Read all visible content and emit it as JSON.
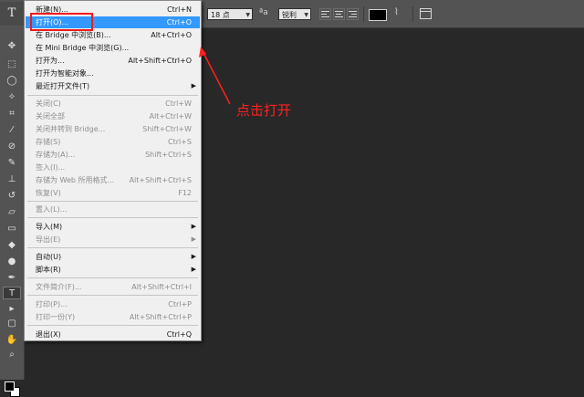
{
  "options_bar": {
    "tool_glyph": "T",
    "font_size": "18 点",
    "aa_glyph": "ªa",
    "aa_mode": "锐利"
  },
  "menu_items": [
    {
      "label": "新建(N)...",
      "shortcut": "Ctrl+N"
    },
    {
      "label": "打开(O)...",
      "shortcut": "Ctrl+O"
    },
    {
      "label": "在 Bridge 中浏览(B)...",
      "shortcut": "Alt+Ctrl+O"
    },
    {
      "label": "在 Mini Bridge 中浏览(G)...",
      "shortcut": ""
    },
    {
      "label": "打开为...",
      "shortcut": "Alt+Shift+Ctrl+O"
    },
    {
      "label": "打开为智能对象...",
      "shortcut": ""
    },
    {
      "label": "最近打开文件(T)",
      "shortcut": ""
    },
    {
      "label": "关闭(C)",
      "shortcut": "Ctrl+W"
    },
    {
      "label": "关闭全部",
      "shortcut": "Alt+Ctrl+W"
    },
    {
      "label": "关闭并转到 Bridge...",
      "shortcut": "Shift+Ctrl+W"
    },
    {
      "label": "存储(S)",
      "shortcut": "Ctrl+S"
    },
    {
      "label": "存储为(A)...",
      "shortcut": "Shift+Ctrl+S"
    },
    {
      "label": "签入(I)...",
      "shortcut": ""
    },
    {
      "label": "存储为 Web 所用格式...",
      "shortcut": "Alt+Shift+Ctrl+S"
    },
    {
      "label": "恢复(V)",
      "shortcut": "F12"
    },
    {
      "label": "置入(L)...",
      "shortcut": ""
    },
    {
      "label": "导入(M)",
      "shortcut": ""
    },
    {
      "label": "导出(E)",
      "shortcut": ""
    },
    {
      "label": "自动(U)",
      "shortcut": ""
    },
    {
      "label": "脚本(R)",
      "shortcut": ""
    },
    {
      "label": "文件简介(F)...",
      "shortcut": "Alt+Shift+Ctrl+I"
    },
    {
      "label": "打印(P)...",
      "shortcut": "Ctrl+P"
    },
    {
      "label": "打印一份(Y)",
      "shortcut": "Alt+Shift+Ctrl+P"
    },
    {
      "label": "退出(X)",
      "shortcut": "Ctrl+Q"
    }
  ],
  "annotation": {
    "text": "点击打开",
    "color": "#ff2020"
  },
  "colors": {
    "highlight": "#3399ff",
    "annotation_box": "#ee1c1c"
  }
}
